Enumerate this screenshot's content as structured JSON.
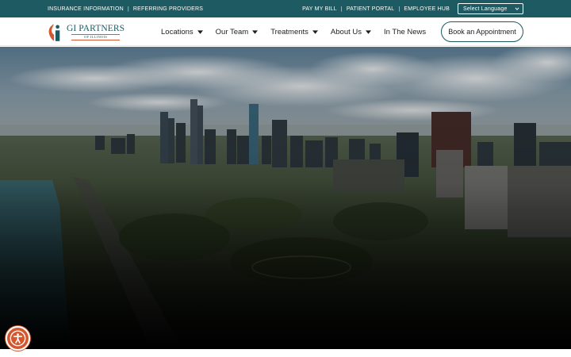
{
  "utility_bar": {
    "left_links": [
      {
        "label": "INSURANCE INFORMATION"
      },
      {
        "label": "REFERRING PROVIDERS"
      }
    ],
    "separator": "|",
    "right_links": [
      {
        "label": "PAY MY BILL"
      },
      {
        "label": "PATIENT PORTAL"
      },
      {
        "label": "EMPLOYEE HUB"
      }
    ],
    "language_select": {
      "value": "Select Language"
    }
  },
  "header": {
    "logo": {
      "main": "GI PARTNERS",
      "sub": "OF ILLINOIS"
    },
    "nav": [
      {
        "label": "Locations",
        "has_dropdown": true
      },
      {
        "label": "Our Team",
        "has_dropdown": true
      },
      {
        "label": "Treatments",
        "has_dropdown": true
      },
      {
        "label": "About Us",
        "has_dropdown": true
      },
      {
        "label": "In The News",
        "has_dropdown": false
      }
    ],
    "cta_label": "Book an Appointment"
  },
  "accessibility": {
    "icon": "accessibility-icon"
  },
  "colors": {
    "brand_teal": "#1d5a62",
    "accent_orange": "#d2592f",
    "text_dark": "#1f1f1f"
  }
}
